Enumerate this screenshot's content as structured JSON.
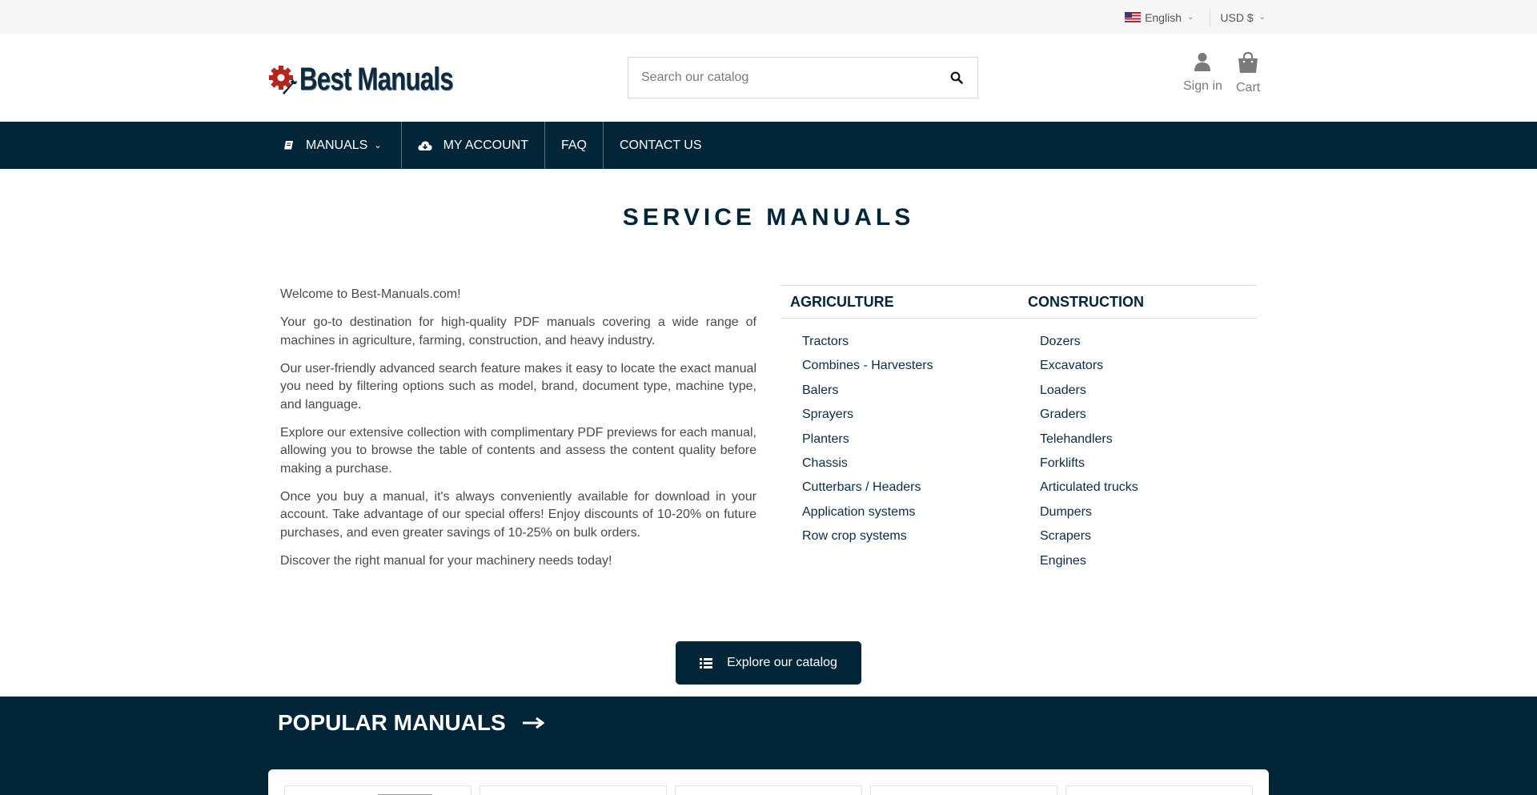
{
  "topbar": {
    "language": "English",
    "currency": "USD $"
  },
  "header": {
    "logo_text": "Best Manuals",
    "search_placeholder": "Search our catalog",
    "signin_label": "Sign in",
    "cart_label": "Cart"
  },
  "nav": {
    "items": [
      {
        "label": "MANUALS",
        "icon": "book-icon",
        "dropdown": true
      },
      {
        "label": "MY ACCOUNT",
        "icon": "cloud-download-icon"
      },
      {
        "label": "FAQ"
      },
      {
        "label": "CONTACT US"
      }
    ]
  },
  "main": {
    "title": "SERVICE MANUALS",
    "intro": [
      "Welcome to Best-Manuals.com!",
      "Your go-to destination for high-quality PDF manuals covering a wide range of machines in agriculture, farming, construction, and heavy industry.",
      "Our user-friendly advanced search feature makes it easy to locate the exact manual you need by filtering options such as model, brand, document type, machine type, and language.",
      "Explore our extensive collection with complimentary PDF previews for each manual, allowing you to browse the table of contents and assess the content quality before making a purchase.",
      "Once you buy a manual, it's always conveniently available for download in your account. Take advantage of our special offers! Enjoy discounts of 10-20% on future purchases, and even greater savings of 10-25% on bulk orders.",
      "Discover the right manual for your machinery needs today!"
    ],
    "categories": {
      "agriculture": {
        "heading": "AGRICULTURE",
        "items": [
          "Tractors",
          "Combines - Harvesters",
          "Balers",
          "Sprayers",
          "Planters",
          "Chassis",
          "Cutterbars / Headers",
          "Application systems",
          "Row crop systems"
        ]
      },
      "construction": {
        "heading": "CONSTRUCTION",
        "items": [
          "Dozers",
          "Excavators",
          "Loaders",
          "Graders",
          "Telehandlers",
          "Forklifts",
          "Articulated trucks",
          "Dumpers",
          "Scrapers",
          "Engines"
        ]
      }
    },
    "explore_label": "Explore our catalog"
  },
  "popular": {
    "title": "POPULAR MANUALS"
  },
  "colors": {
    "brand_dark": "#032538",
    "logo_red": "#b3261e"
  }
}
